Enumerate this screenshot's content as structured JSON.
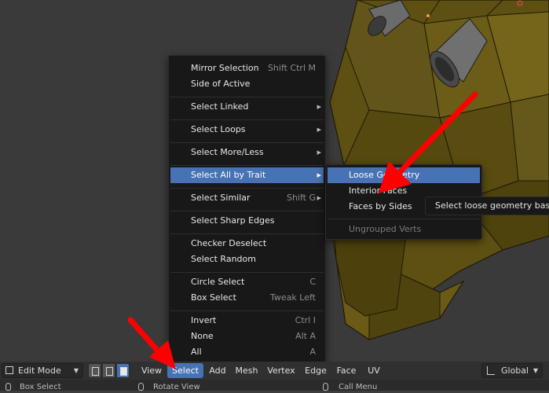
{
  "select_menu": {
    "items": [
      {
        "label": "Mirror Selection",
        "shortcut": "Shift Ctrl M"
      },
      {
        "label": "Side of Active",
        "shortcut": ""
      },
      {
        "label": "Select Linked",
        "shortcut": ""
      },
      {
        "label": "Select Loops",
        "shortcut": ""
      },
      {
        "label": "Select More/Less",
        "shortcut": ""
      },
      {
        "label": "Select All by Trait",
        "shortcut": ""
      },
      {
        "label": "Select Similar",
        "shortcut": "Shift G"
      },
      {
        "label": "Select Sharp Edges",
        "shortcut": ""
      },
      {
        "label": "Checker Deselect",
        "shortcut": ""
      },
      {
        "label": "Select Random",
        "shortcut": ""
      },
      {
        "label": "Circle Select",
        "shortcut": "C"
      },
      {
        "label": "Box Select",
        "shortcut": "Tweak Left"
      },
      {
        "label": "Invert",
        "shortcut": "Ctrl I"
      },
      {
        "label": "None",
        "shortcut": "Alt A"
      },
      {
        "label": "All",
        "shortcut": "A"
      }
    ]
  },
  "trait_submenu": {
    "items": [
      {
        "label": "Loose Geometry"
      },
      {
        "label": "Interior Faces"
      },
      {
        "label": "Faces by Sides"
      },
      {
        "label": "Ungrouped Verts"
      }
    ]
  },
  "tooltip": {
    "text": "Select loose geometry based"
  },
  "header": {
    "mode": "Edit Mode",
    "menus": [
      "View",
      "Select",
      "Add",
      "Mesh",
      "Vertex",
      "Edge",
      "Face",
      "UV"
    ],
    "orientation": "Global",
    "active_menu": "Select"
  },
  "status_bar": {
    "left": "Box Select",
    "middle": "Rotate View",
    "right": "Call Menu"
  },
  "colors": {
    "highlight": "#4772b3",
    "menu_bg": "#181818",
    "annotation_arrow": "#ff0000",
    "model": "#6b5a14"
  }
}
